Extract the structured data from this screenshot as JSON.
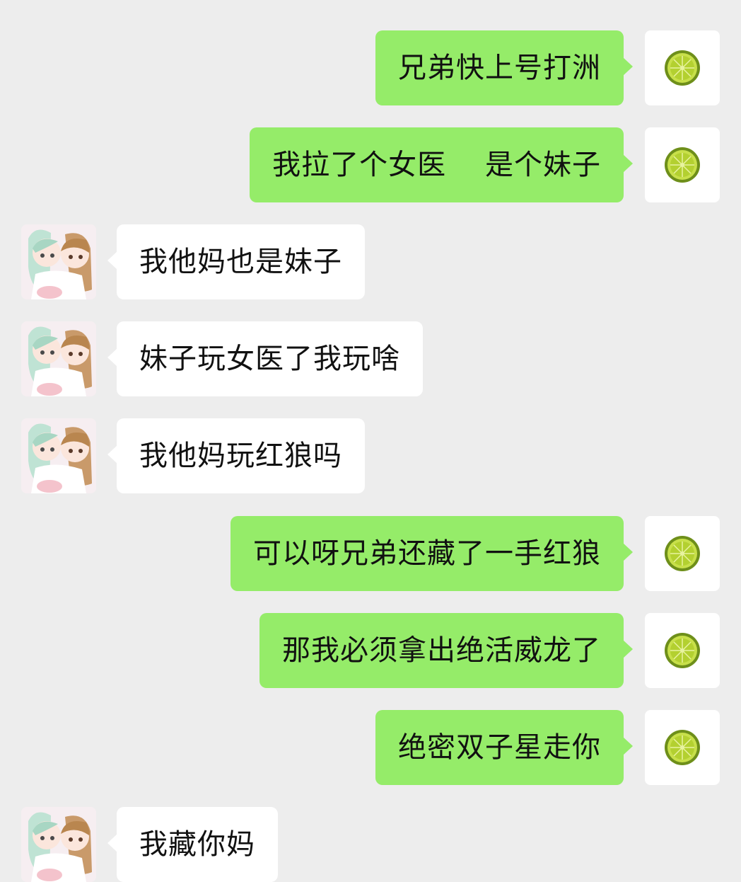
{
  "colors": {
    "background": "#ededed",
    "outgoing_bubble": "#95ec69",
    "incoming_bubble": "#ffffff"
  },
  "avatars": {
    "self": "lime-slice-avatar",
    "other": "anime-girls-avatar"
  },
  "messages": [
    {
      "from": "self",
      "text": "兄弟快上号打洲"
    },
    {
      "from": "self",
      "text": "我拉了个女医    是个妹子"
    },
    {
      "from": "other",
      "text": "我他妈也是妹子"
    },
    {
      "from": "other",
      "text": "妹子玩女医了我玩啥"
    },
    {
      "from": "other",
      "text": "我他妈玩红狼吗"
    },
    {
      "from": "self",
      "text": "可以呀兄弟还藏了一手红狼"
    },
    {
      "from": "self",
      "text": "那我必须拿出绝活威龙了"
    },
    {
      "from": "self",
      "text": "绝密双子星走你"
    },
    {
      "from": "other",
      "text": "我藏你妈"
    }
  ]
}
